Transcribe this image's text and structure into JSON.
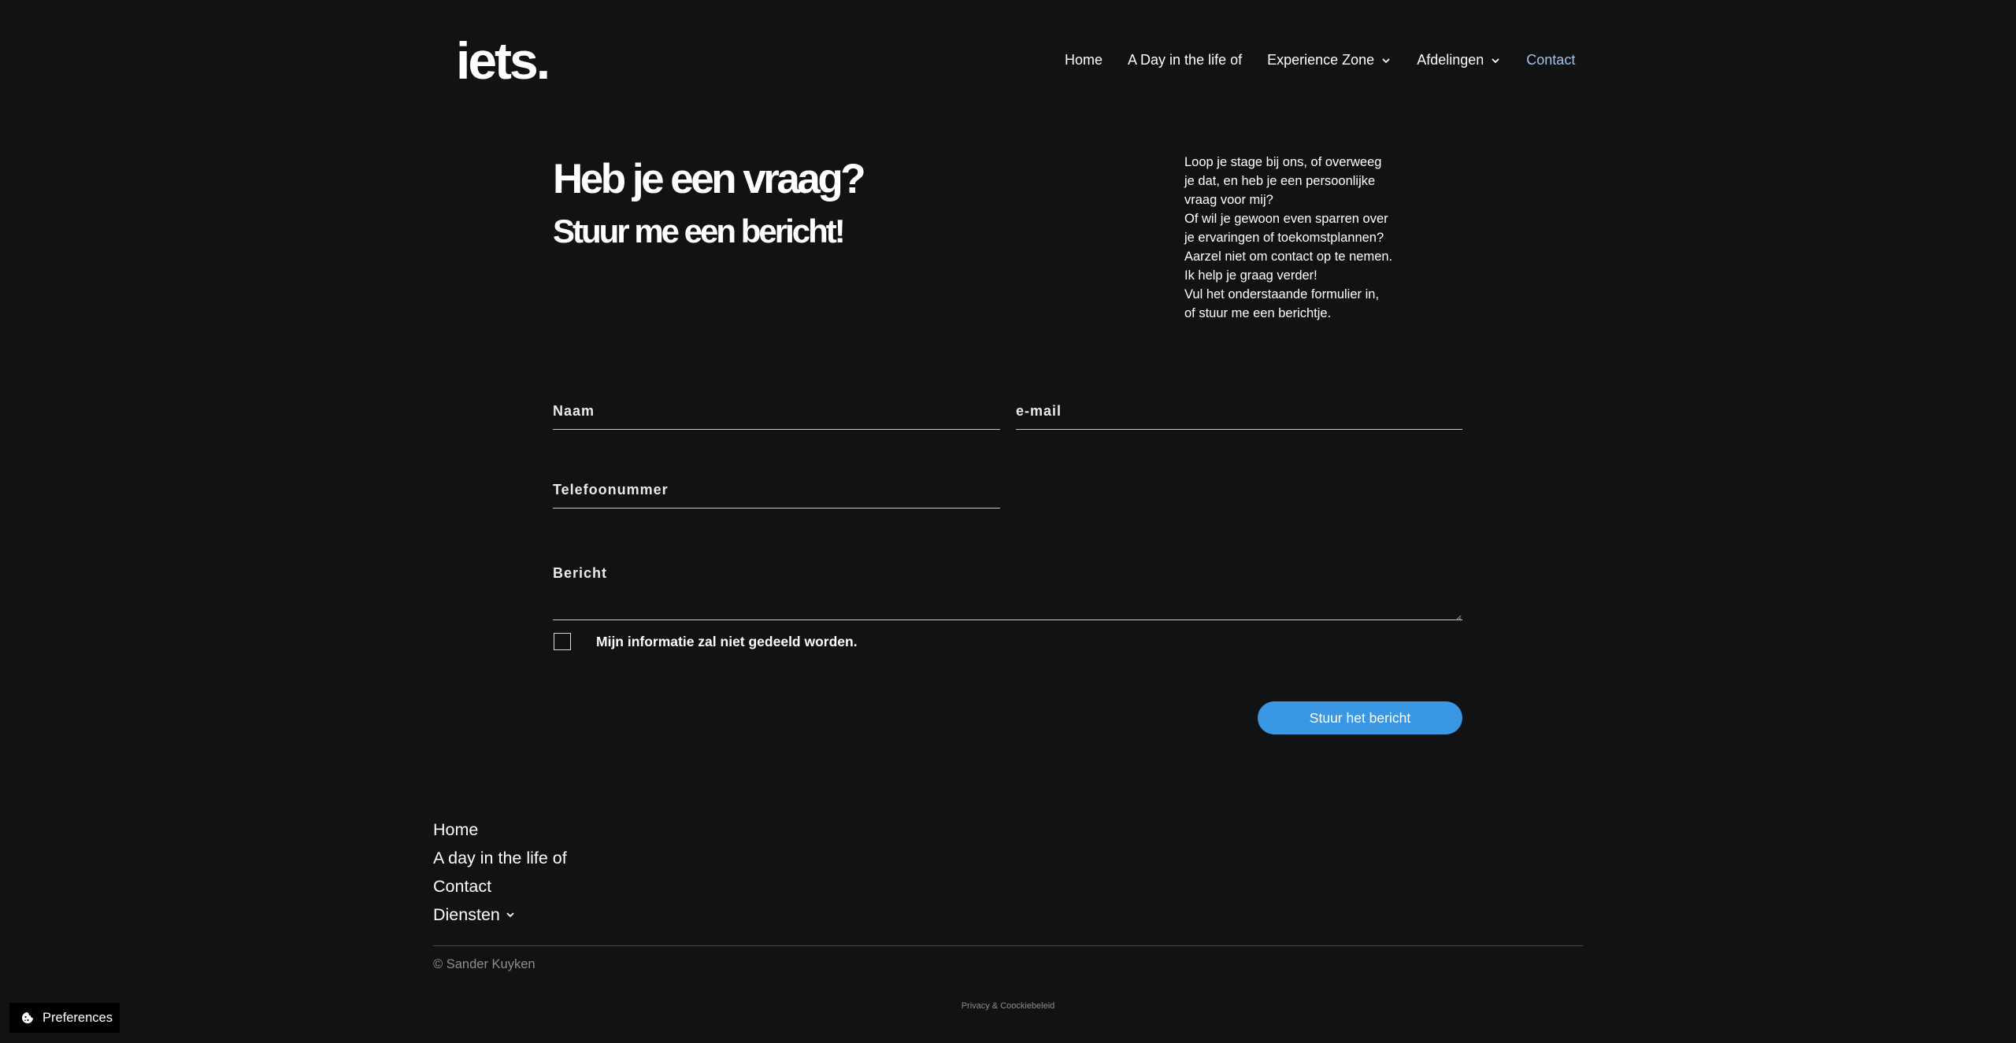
{
  "brand": {
    "logo": "iets."
  },
  "nav": {
    "items": [
      {
        "label": "Home",
        "dropdown": false,
        "active": false
      },
      {
        "label": "A Day in the life of",
        "dropdown": false,
        "active": false
      },
      {
        "label": "Experience Zone",
        "dropdown": true,
        "active": false
      },
      {
        "label": "Afdelingen",
        "dropdown": true,
        "active": false
      },
      {
        "label": "Contact",
        "dropdown": false,
        "active": true
      }
    ]
  },
  "hero": {
    "title": "Heb je een vraag?",
    "subtitle": "Stuur me een bericht!"
  },
  "intro": {
    "lines": [
      "Loop je stage bij ons, of overweeg",
      "je dat, en heb je een persoonlijke",
      "vraag voor mij?",
      "Of wil je gewoon even sparren over",
      "je ervaringen of toekomstplannen?",
      "Aarzel niet om contact op te nemen.",
      "Ik help je graag verder!",
      "Vul het onderstaande formulier in,",
      "of stuur me een berichtje."
    ]
  },
  "form": {
    "name_label": "Naam",
    "email_label": "e-mail",
    "phone_label": "Telefoonummer",
    "message_label": "Bericht",
    "consent_label": "Mijn informatie zal niet gedeeld worden.",
    "consent_checked": false,
    "submit_label": "Stuur het bericht"
  },
  "footer": {
    "nav": [
      {
        "label": "Home",
        "dropdown": false
      },
      {
        "label": "A day in the life of",
        "dropdown": false
      },
      {
        "label": "Contact",
        "dropdown": false
      },
      {
        "label": "Diensten",
        "dropdown": true
      }
    ],
    "copyright": "© Sander Kuyken",
    "privacy_link": "Privacy & Coockiebeleid"
  },
  "cookie_prefs": {
    "label": "Preferences"
  },
  "colors": {
    "background": "#111213",
    "accent": "#3a97e4",
    "active_nav": "#9fc4ea",
    "muted_text": "#8d8d8d"
  }
}
